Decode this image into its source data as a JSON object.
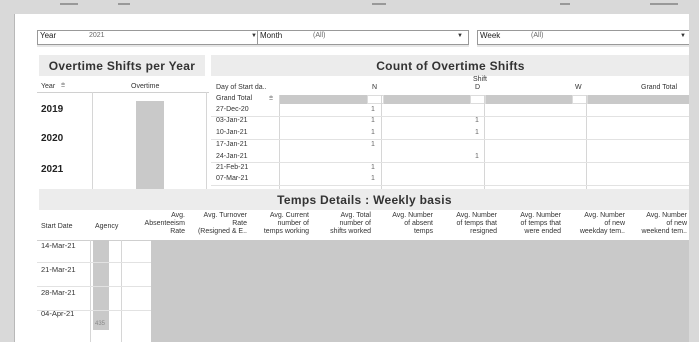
{
  "filters": {
    "year": {
      "label": "Year",
      "value": "2021"
    },
    "month": {
      "label": "Month",
      "value": "(All)"
    },
    "week": {
      "label": "Week",
      "value": "(All)"
    }
  },
  "overtime_per_year": {
    "title": "Overtime Shifts per Year",
    "col_year": "Year",
    "col_overtime": "Overtime",
    "years": [
      "2019",
      "2020",
      "2021"
    ]
  },
  "overtime_count": {
    "title": "Count of Overtime Shifts",
    "shift_header": "Shift",
    "row_header": "Day of Start da..",
    "columns": [
      "N",
      "D",
      "W",
      "Grand Total"
    ],
    "rows": [
      {
        "label": "Grand Total",
        "N": "",
        "D": ""
      },
      {
        "label": "27-Dec-20",
        "N": "1",
        "D": ""
      },
      {
        "label": "03-Jan-21",
        "N": "1",
        "D": "1"
      },
      {
        "label": "10-Jan-21",
        "N": "1",
        "D": "1"
      },
      {
        "label": "17-Jan-21",
        "N": "1",
        "D": ""
      },
      {
        "label": "24-Jan-21",
        "N": "",
        "D": "1"
      },
      {
        "label": "21-Feb-21",
        "N": "1",
        "D": ""
      },
      {
        "label": "07-Mar-21",
        "N": "1",
        "D": ""
      }
    ]
  },
  "temps": {
    "title": "Temps Details : Weekly basis",
    "col_start_date": "Start Date",
    "col_agency": "Agency",
    "metrics": [
      [
        "Avg.",
        "Absenteeism",
        "Rate"
      ],
      [
        "Avg. Turnover",
        "Rate",
        "(Resigned & E.."
      ],
      [
        "Avg. Current",
        "number of",
        "temps working"
      ],
      [
        "Avg. Total",
        "number of",
        "shifts worked"
      ],
      [
        "Avg. Number",
        "of absent",
        "temps"
      ],
      [
        "Avg. Number",
        "of temps that",
        "resigned"
      ],
      [
        "Avg. Number",
        "of temps that",
        "were ended"
      ],
      [
        "Avg. Number",
        "of new",
        "weekday tem.."
      ],
      [
        "Avg. Number",
        "of new",
        "weekend tem.."
      ]
    ],
    "dates": [
      "14-Mar-21",
      "21-Mar-21",
      "28-Mar-21",
      "04-Apr-21"
    ],
    "footnote": "435"
  }
}
